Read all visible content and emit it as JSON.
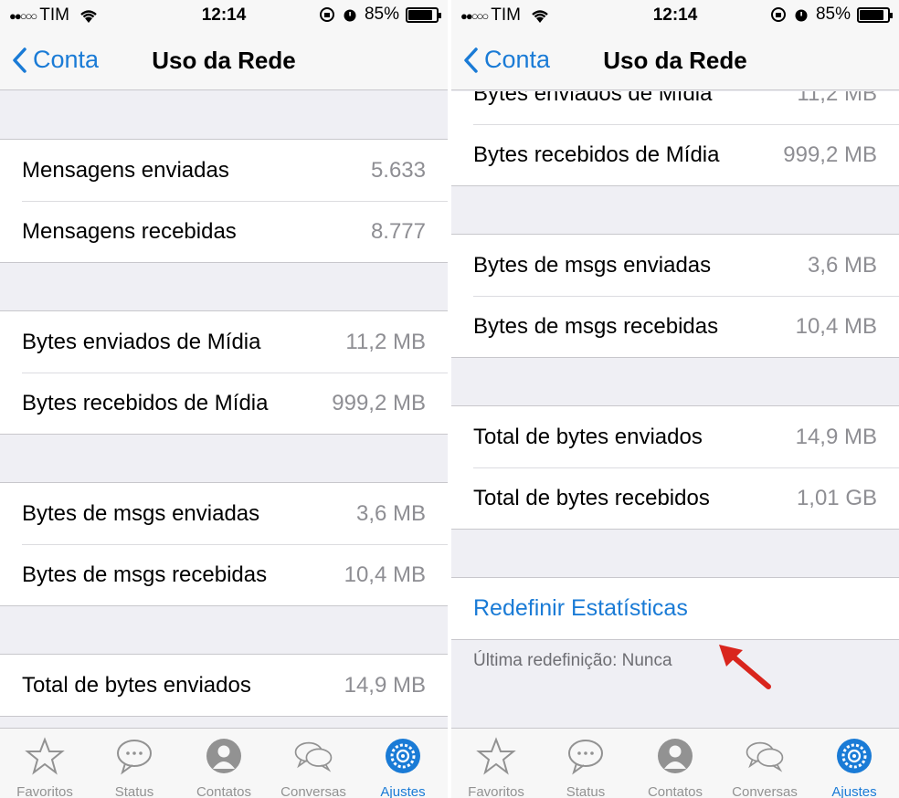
{
  "status": {
    "carrier": "TIM",
    "time": "12:14",
    "battery": "85%"
  },
  "nav": {
    "back_label": "Conta",
    "title": "Uso da Rede"
  },
  "left": {
    "groups": [
      [
        {
          "label": "Mensagens enviadas",
          "value": "5.633"
        },
        {
          "label": "Mensagens recebidas",
          "value": "8.777"
        }
      ],
      [
        {
          "label": "Bytes enviados de Mídia",
          "value": "11,2 MB"
        },
        {
          "label": "Bytes recebidos de Mídia",
          "value": "999,2 MB"
        }
      ],
      [
        {
          "label": "Bytes de msgs enviadas",
          "value": "3,6 MB"
        },
        {
          "label": "Bytes de msgs recebidas",
          "value": "10,4 MB"
        }
      ],
      [
        {
          "label": "Total de bytes enviados",
          "value": "14,9 MB"
        }
      ]
    ]
  },
  "right": {
    "groups": [
      [
        {
          "label": "Bytes enviados de Mídia",
          "value": "11,2 MB"
        },
        {
          "label": "Bytes recebidos de Mídia",
          "value": "999,2 MB"
        }
      ],
      [
        {
          "label": "Bytes de msgs enviadas",
          "value": "3,6 MB"
        },
        {
          "label": "Bytes de msgs recebidas",
          "value": "10,4 MB"
        }
      ],
      [
        {
          "label": "Total de bytes enviados",
          "value": "14,9 MB"
        },
        {
          "label": "Total de bytes recebidos",
          "value": "1,01 GB"
        }
      ]
    ],
    "reset_label": "Redefinir Estatísticas",
    "last_reset": "Última redefinição: Nunca"
  },
  "tabs": [
    {
      "label": "Favoritos",
      "icon": "star-icon"
    },
    {
      "label": "Status",
      "icon": "chat-bubble-icon"
    },
    {
      "label": "Contatos",
      "icon": "person-icon"
    },
    {
      "label": "Conversas",
      "icon": "chat-bubbles-icon"
    },
    {
      "label": "Ajustes",
      "icon": "gear-icon",
      "active": true
    }
  ],
  "colors": {
    "accent": "#1a7bd6",
    "arrow": "#d9251d",
    "background": "#efeff4"
  }
}
